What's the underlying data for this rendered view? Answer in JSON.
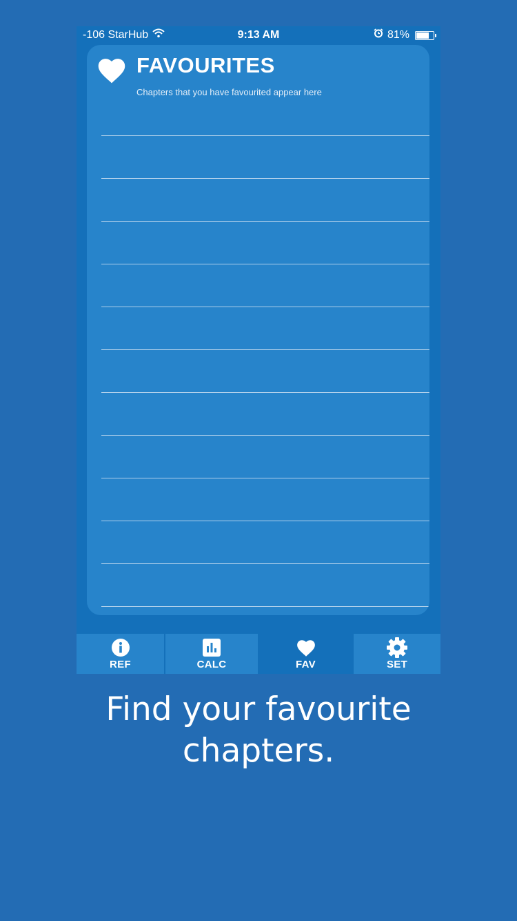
{
  "status_bar": {
    "carrier": "-106 StarHub",
    "time": "9:13 AM",
    "battery": "81%",
    "battery_level": 0.81
  },
  "favourites": {
    "title": "FAVOURITES",
    "subtitle": "Chapters that you have favourited appear here",
    "rows": [
      "",
      "",
      "",
      "",
      "",
      "",
      "",
      "",
      "",
      "",
      "",
      ""
    ]
  },
  "tabs": [
    {
      "label": "REF",
      "icon": "info-icon",
      "active": false
    },
    {
      "label": "CALC",
      "icon": "bar-chart-icon",
      "active": false
    },
    {
      "label": "FAV",
      "icon": "heart-icon",
      "active": true
    },
    {
      "label": "SET",
      "icon": "gear-icon",
      "active": false
    }
  ],
  "caption": {
    "line1": "Find your favourite",
    "line2": "chapters."
  },
  "colors": {
    "background": "#236cb4",
    "phone_background": "#1470ba",
    "card": "#2784cb",
    "text": "#ffffff"
  }
}
